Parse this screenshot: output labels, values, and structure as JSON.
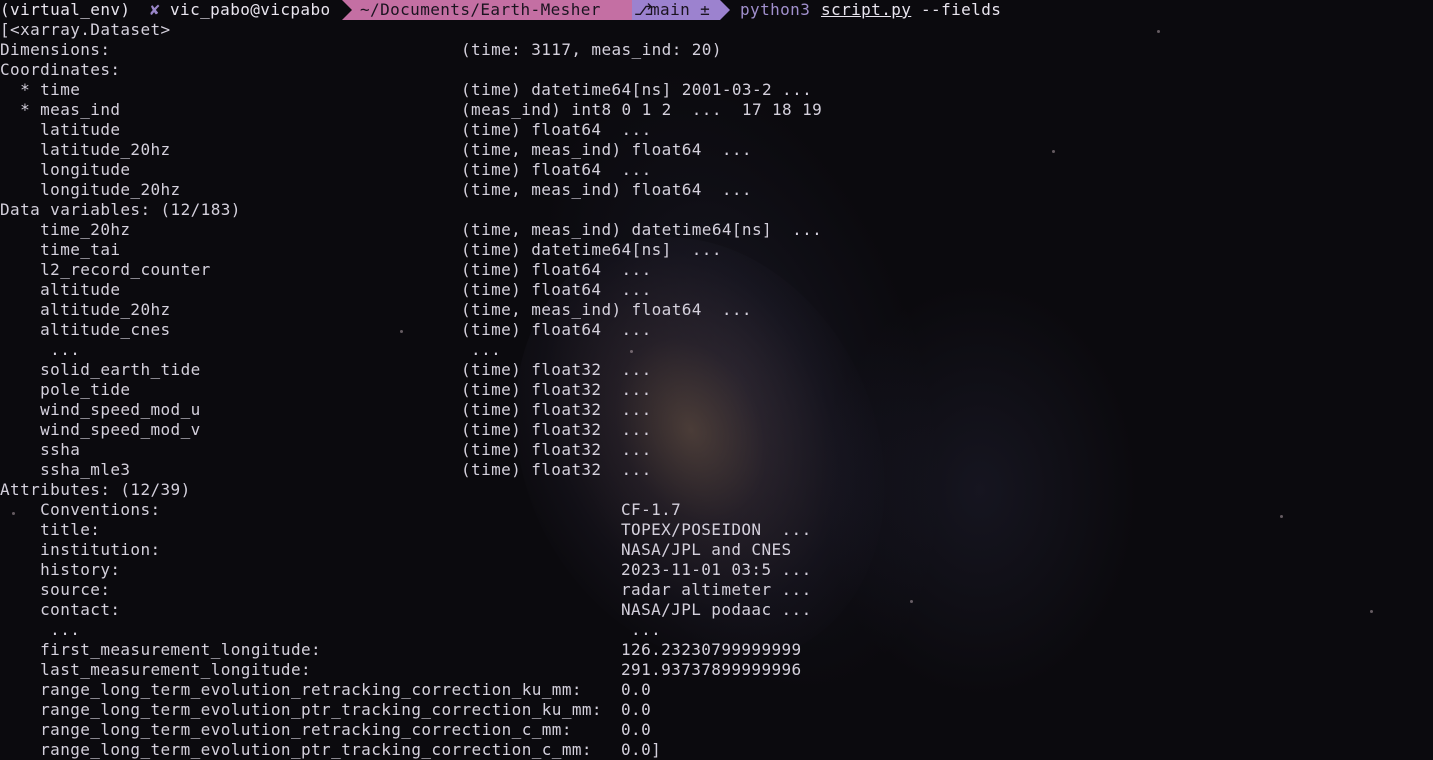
{
  "prompt": {
    "venv": "(virtual_env)",
    "x_icon": "✘",
    "user_host": "vic_pabo@vicpabo",
    "path": "~/Documents/Earth-Mesher",
    "branch_icon": "⎇",
    "branch": "main ±",
    "command": "python3",
    "script": "script.py",
    "flag": "--fields"
  },
  "output": {
    "header": "[<xarray.Dataset>",
    "dimensions": {
      "label": "Dimensions:",
      "value": "(time: 3117, meas_ind: 20)"
    },
    "coordinates": {
      "label": "Coordinates:",
      "rows": [
        {
          "name": "  * time",
          "value": "(time) datetime64[ns] 2001-03-2 ..."
        },
        {
          "name": "  * meas_ind",
          "value": "(meas_ind) int8 0 1 2  ...  17 18 19"
        },
        {
          "name": "    latitude",
          "value": "(time) float64  ..."
        },
        {
          "name": "    latitude_20hz",
          "value": "(time, meas_ind) float64  ..."
        },
        {
          "name": "    longitude",
          "value": "(time) float64  ..."
        },
        {
          "name": "    longitude_20hz",
          "value": "(time, meas_ind) float64  ..."
        }
      ]
    },
    "data_variables": {
      "label": "Data variables: (12/183)",
      "rows": [
        {
          "name": "    time_20hz",
          "value": "(time, meas_ind) datetime64[ns]  ..."
        },
        {
          "name": "    time_tai",
          "value": "(time) datetime64[ns]  ..."
        },
        {
          "name": "    l2_record_counter",
          "value": "(time) float64  ..."
        },
        {
          "name": "    altitude",
          "value": "(time) float64  ..."
        },
        {
          "name": "    altitude_20hz",
          "value": "(time, meas_ind) float64  ..."
        },
        {
          "name": "    altitude_cnes",
          "value": "(time) float64  ..."
        },
        {
          "name": "     ...",
          "value": " ..."
        },
        {
          "name": "    solid_earth_tide",
          "value": "(time) float32  ..."
        },
        {
          "name": "    pole_tide",
          "value": "(time) float32  ..."
        },
        {
          "name": "    wind_speed_mod_u",
          "value": "(time) float32  ..."
        },
        {
          "name": "    wind_speed_mod_v",
          "value": "(time) float32  ..."
        },
        {
          "name": "    ssha",
          "value": "(time) float32  ..."
        },
        {
          "name": "    ssha_mle3",
          "value": "(time) float32  ..."
        }
      ]
    },
    "attributes": {
      "label": "Attributes: (12/39)",
      "rows": [
        {
          "name": "    Conventions:",
          "value": "CF-1.7"
        },
        {
          "name": "    title:",
          "value": "TOPEX/POSEIDON  ..."
        },
        {
          "name": "    institution:",
          "value": "NASA/JPL and CNES"
        },
        {
          "name": "    history:",
          "value": "2023-11-01 03:5 ..."
        },
        {
          "name": "    source:",
          "value": "radar altimeter ..."
        },
        {
          "name": "    contact:",
          "value": "NASA/JPL podaac ..."
        },
        {
          "name": "     ...",
          "value": " ..."
        },
        {
          "name": "    first_measurement_longitude:",
          "value": "126.23230799999999"
        },
        {
          "name": "    last_measurement_longitude:",
          "value": "291.93737899999996"
        }
      ],
      "long_rows": [
        {
          "name": "    range_long_term_evolution_retracking_correction_ku_mm:",
          "value": "0.0"
        },
        {
          "name": "    range_long_term_evolution_ptr_tracking_correction_ku_mm:",
          "value": "0.0"
        },
        {
          "name": "    range_long_term_evolution_retracking_correction_c_mm:",
          "value": "0.0"
        },
        {
          "name": "    range_long_term_evolution_ptr_tracking_correction_c_mm:",
          "value": "0.0]"
        }
      ]
    }
  }
}
